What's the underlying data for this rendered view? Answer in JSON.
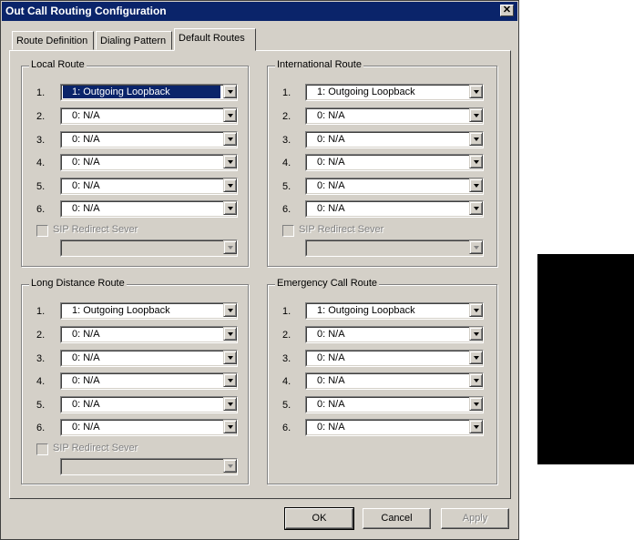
{
  "window": {
    "title": "Out Call Routing Configuration",
    "close_glyph": "✕"
  },
  "tabs": [
    {
      "label": "Route Definition",
      "active": false
    },
    {
      "label": "Dialing Pattern",
      "active": false
    },
    {
      "label": "Default Routes",
      "active": true
    }
  ],
  "groups": {
    "local": {
      "title": "Local Route",
      "rows": [
        {
          "num": "1.",
          "value": "1: Outgoing Loopback"
        },
        {
          "num": "2.",
          "value": "0: N/A"
        },
        {
          "num": "3.",
          "value": "0: N/A"
        },
        {
          "num": "4.",
          "value": "0: N/A"
        },
        {
          "num": "5.",
          "value": "0: N/A"
        },
        {
          "num": "6.",
          "value": "0: N/A"
        }
      ],
      "sip_label": "SIP Redirect Sever",
      "sip_value": ""
    },
    "international": {
      "title": "International Route",
      "rows": [
        {
          "num": "1.",
          "value": "1: Outgoing Loopback"
        },
        {
          "num": "2.",
          "value": "0: N/A"
        },
        {
          "num": "3.",
          "value": "0: N/A"
        },
        {
          "num": "4.",
          "value": "0: N/A"
        },
        {
          "num": "5.",
          "value": "0: N/A"
        },
        {
          "num": "6.",
          "value": "0: N/A"
        }
      ],
      "sip_label": "SIP Redirect Sever",
      "sip_value": ""
    },
    "long_distance": {
      "title": "Long Distance Route",
      "rows": [
        {
          "num": "1.",
          "value": "1: Outgoing Loopback"
        },
        {
          "num": "2.",
          "value": "0: N/A"
        },
        {
          "num": "3.",
          "value": "0: N/A"
        },
        {
          "num": "4.",
          "value": "0: N/A"
        },
        {
          "num": "5.",
          "value": "0: N/A"
        },
        {
          "num": "6.",
          "value": "0: N/A"
        }
      ],
      "sip_label": "SIP Redirect Sever",
      "sip_value": ""
    },
    "emergency": {
      "title": "Emergency Call Route",
      "rows": [
        {
          "num": "1.",
          "value": "1: Outgoing Loopback"
        },
        {
          "num": "2.",
          "value": "0: N/A"
        },
        {
          "num": "3.",
          "value": "0: N/A"
        },
        {
          "num": "4.",
          "value": "0: N/A"
        },
        {
          "num": "5.",
          "value": "0: N/A"
        },
        {
          "num": "6.",
          "value": "0: N/A"
        }
      ]
    }
  },
  "buttons": {
    "ok": "OK",
    "cancel": "Cancel",
    "apply": "Apply"
  },
  "colors": {
    "titlebar": "#0a246a",
    "face": "#d4d0c8",
    "selection": "#0a246a"
  }
}
